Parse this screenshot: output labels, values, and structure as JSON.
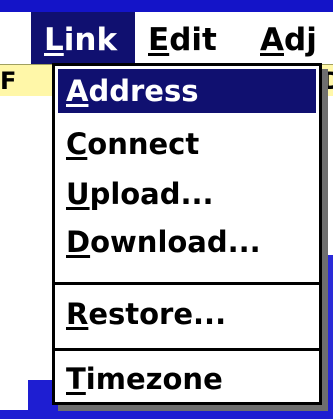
{
  "menubar": {
    "items": [
      {
        "label": "Link",
        "mnemonic": "L",
        "rest": "ink",
        "active": true
      },
      {
        "label": "Edit",
        "mnemonic": "E",
        "rest": "dit",
        "active": false
      },
      {
        "label": "Adj",
        "mnemonic": "A",
        "rest": "dj",
        "active": false
      }
    ]
  },
  "background": {
    "yellow_left_glyph": "F",
    "yellow_right_glyph": "D"
  },
  "dropdown": {
    "items": [
      {
        "label": "Address",
        "mnemonic": "A",
        "rest": "ddress",
        "selected": true
      },
      {
        "label": "Connect",
        "mnemonic": "C",
        "rest": "onnect",
        "selected": false
      },
      {
        "label": "Upload...",
        "mnemonic": "U",
        "rest": "pload...",
        "selected": false
      },
      {
        "label": "Download...",
        "mnemonic": "D",
        "rest": "ownload...",
        "selected": false
      },
      {
        "label": "Restore...",
        "mnemonic": "R",
        "rest": "estore...",
        "selected": false
      },
      {
        "label": "Timezone",
        "mnemonic": "T",
        "rest": "imezone",
        "selected": false
      }
    ]
  },
  "colors": {
    "selection": "#101070",
    "title_blue": "#1414c8",
    "yellow": "#fff7a8"
  }
}
